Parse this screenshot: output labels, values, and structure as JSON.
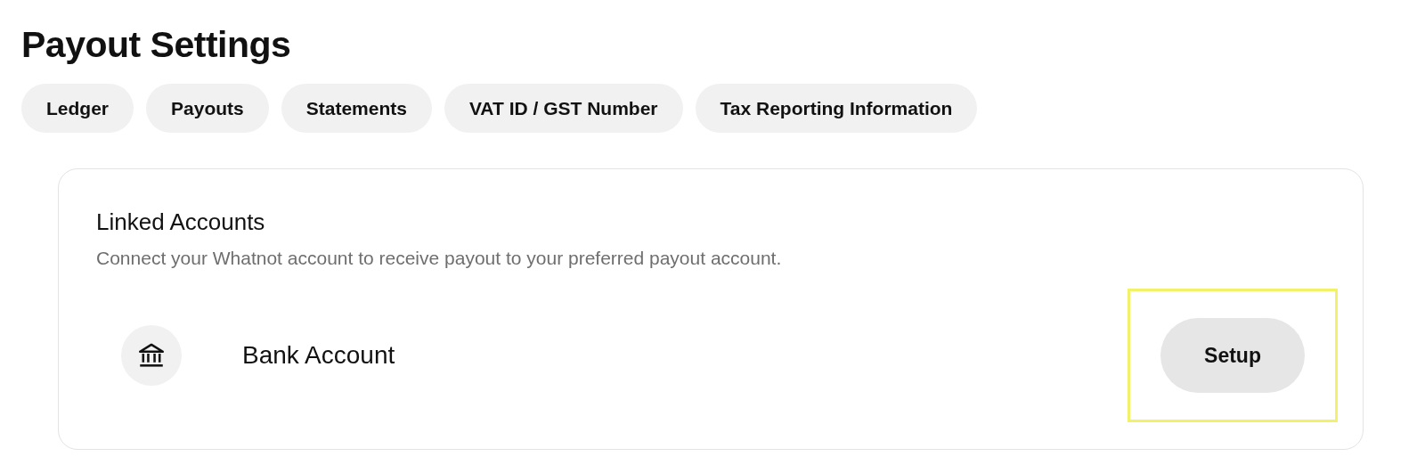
{
  "page_title": "Payout Settings",
  "tabs": [
    {
      "label": "Ledger"
    },
    {
      "label": "Payouts"
    },
    {
      "label": "Statements"
    },
    {
      "label": "VAT ID / GST Number"
    },
    {
      "label": "Tax Reporting Information"
    }
  ],
  "linked_accounts": {
    "title": "Linked Accounts",
    "description": "Connect your Whatnot account to receive payout to your preferred payout account.",
    "accounts": [
      {
        "name": "Bank Account",
        "button": "Setup",
        "highlighted": true
      }
    ]
  }
}
